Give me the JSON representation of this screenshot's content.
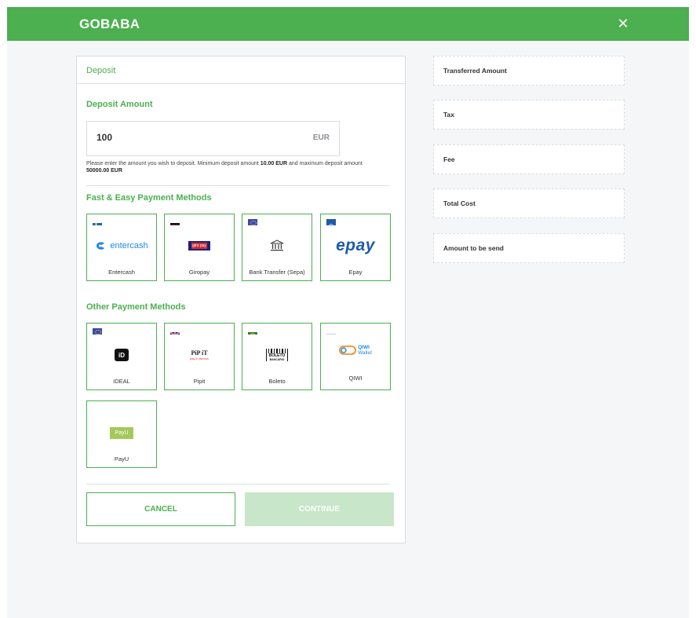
{
  "app": {
    "brand": "GOBABA",
    "close_icon": "close-icon"
  },
  "deposit": {
    "header": "Deposit",
    "amount_section_title": "Deposit Amount",
    "amount_value": "100",
    "currency": "EUR",
    "help_prefix": "Please enter the amount you wish to deposit. Minimum deposit amount ",
    "min_amount": "10.00 EUR",
    "help_middle": " and maximum deposit amount ",
    "max_amount": "50000.00 EUR",
    "fast_methods_title": "Fast & Easy Payment Methods",
    "other_methods_title": "Other Payment Methods",
    "fast_methods": [
      {
        "name": "Entercash",
        "logo_text": "entercash",
        "flag": "sweden"
      },
      {
        "name": "Giropay",
        "logo_text": "giro pay",
        "flag": "germany"
      },
      {
        "name": "Bank Transfer (Sepa)",
        "logo_text": "",
        "flag": "eu"
      },
      {
        "name": "Epay",
        "logo_text": "epay",
        "flag": "epay"
      }
    ],
    "other_methods": [
      {
        "name": "IDEAL",
        "logo_text": "iD",
        "flag": "eu"
      },
      {
        "name": "Pipit",
        "logo_text": "PiP iT",
        "logo_subtext": "pay in person",
        "flag": "uk"
      },
      {
        "name": "Boleto",
        "logo_text": "BOLETO",
        "logo_subtext": "BANCÁRIO",
        "flag": "brazil"
      },
      {
        "name": "QIWI",
        "logo_text": "QIWI",
        "logo_subtext": "Wallet",
        "flag": "russia"
      },
      {
        "name": "PayU",
        "logo_text": "PayU",
        "flag": "poland"
      }
    ],
    "cancel_label": "CANCEL",
    "continue_label": "CONTINUE"
  },
  "summary": [
    {
      "label": "Transferred Amount"
    },
    {
      "label": "Tax"
    },
    {
      "label": "Fee"
    },
    {
      "label": "Total Cost"
    },
    {
      "label": "Amount to be send"
    }
  ],
  "colors": {
    "brand_green": "#4caf50",
    "disabled_green": "#c8e6c9",
    "border_gray": "#d8dde2",
    "background": "#f5f6f8"
  }
}
